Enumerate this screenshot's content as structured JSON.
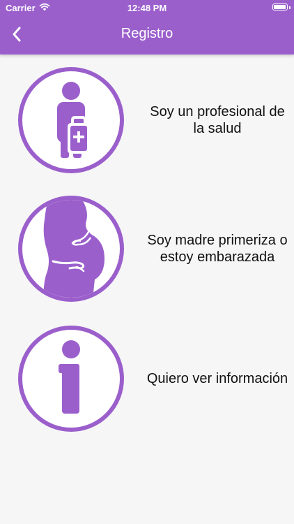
{
  "status_bar": {
    "carrier": "Carrier",
    "time": "12:48 PM",
    "icons": [
      "wifi-icon",
      "battery-icon"
    ],
    "battery_level": 0.95
  },
  "nav": {
    "title": "Registro",
    "back_icon": "chevron-left-icon"
  },
  "options": [
    {
      "label": "Soy un profesional de la salud",
      "icon": "health-professional-icon"
    },
    {
      "label": "Soy madre primeriza o estoy embarazada",
      "icon": "pregnant-woman-icon"
    },
    {
      "label": "Quiero ver información",
      "icon": "info-icon"
    }
  ],
  "colors": {
    "accent": "#9b5fcc",
    "background": "#f6f6f6",
    "text": "#111111"
  }
}
